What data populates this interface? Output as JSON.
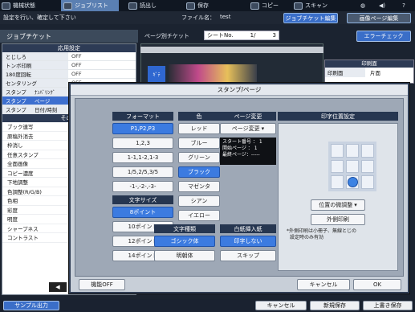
{
  "topbar": {
    "tabs": [
      {
        "label": "機械状態",
        "icon": "machine-status-icon"
      },
      {
        "label": "ジョブリスト",
        "icon": "job-list-icon"
      },
      {
        "label": "読出し",
        "icon": "read-icon"
      },
      {
        "label": "保存",
        "icon": "save-icon"
      },
      {
        "label": "コピー",
        "icon": "copy-icon"
      },
      {
        "label": "スキャン",
        "icon": "scan-icon"
      }
    ]
  },
  "message": {
    "text": "設定を行い、確定して下さい",
    "file_name_label": "ファイル名：",
    "file_name_value": "test",
    "job_ticket_edit": "ジョブチケット編集",
    "image_page_edit": "画像ページ編集"
  },
  "left": {
    "title": "ジョブチケット",
    "section_applied": "応用設定",
    "rows": [
      {
        "key": "とじしろ",
        "value": "OFF"
      },
      {
        "key": "トンボ印刷",
        "value": "OFF"
      },
      {
        "key": "180度回転",
        "value": "OFF"
      },
      {
        "key": "センタリング",
        "value": "OFF"
      },
      {
        "key": "スタンプ",
        "key2": "ﾅﾝﾊﾞﾘﾝｸﾞ",
        "value": ""
      },
      {
        "key": "スタンプ",
        "key2": "ページ",
        "value": ""
      },
      {
        "key": "スタンプ",
        "key2": "日付/時刻",
        "value": ""
      }
    ],
    "section_other": "その他",
    "items": [
      "ブック連写",
      "原稿外消去",
      "枠消し",
      "任意スタンプ",
      "全面画像",
      "コピー濃度",
      "下地調整",
      "色調整(R/G/B)",
      "色相",
      "彩度",
      "明度",
      "シャープネス",
      "コントラスト"
    ]
  },
  "right_bg": {
    "page_ticket_label": "ページ別チケット",
    "sheet_no_label": "シートNo.",
    "sheet_current": "1/",
    "sheet_total": "3",
    "error_check": "エラーチェック",
    "print_side_header": "印刷面",
    "print_side_label": "印刷面",
    "print_side_value": "片面"
  },
  "dialog": {
    "title": "スタンプ/ページ",
    "format_header": "フォーマット",
    "formats": [
      "P1,P2,P3",
      "1,2,3",
      "1-1,1-2,1-3",
      "1/5,2/5,3/5",
      "-1-,-2-,-3-"
    ],
    "format_selected": 0,
    "color_header": "色",
    "colors": [
      "レッド",
      "ブルー",
      "グリーン",
      "ブラック",
      "マゼンタ",
      "シアン",
      "イエロー"
    ],
    "color_selected": 3,
    "size_header": "文字サイズ",
    "sizes": [
      "8ポイント",
      "10ポイント",
      "12ポイント",
      "14ポイント"
    ],
    "size_selected": 0,
    "font_header": "文字種類",
    "fonts": [
      "ゴシック体",
      "明朝体"
    ],
    "font_selected": 0,
    "page_change_header": "ページ変更",
    "page_change_button": "ページ変更",
    "counter": {
      "start_label": "スタート番号 ：",
      "start_value": "1",
      "first_label": "開始ページ ：",
      "first_value": "1",
      "last_label": "最終ページ：",
      "last_value": "-----"
    },
    "blank_header": "白紙挿入紙",
    "blank_options": [
      "印字しない",
      "スキップ"
    ],
    "blank_selected": 0,
    "position_header": "印字位置設定",
    "position_selected": 7,
    "fine_adjust": "位置の微調整",
    "outside_print": "外側印刷",
    "note_line1": "*外側印刷は小冊子、無線とじの",
    "note_line2": "設定時のみ有効",
    "func_off": "機能OFF",
    "cancel": "キャンセル",
    "ok": "OK"
  },
  "bottom": {
    "sample_output": "サンプル出力",
    "cancel": "キャンセル",
    "new_save": "新規保存",
    "overwrite_save": "上書き保存"
  }
}
